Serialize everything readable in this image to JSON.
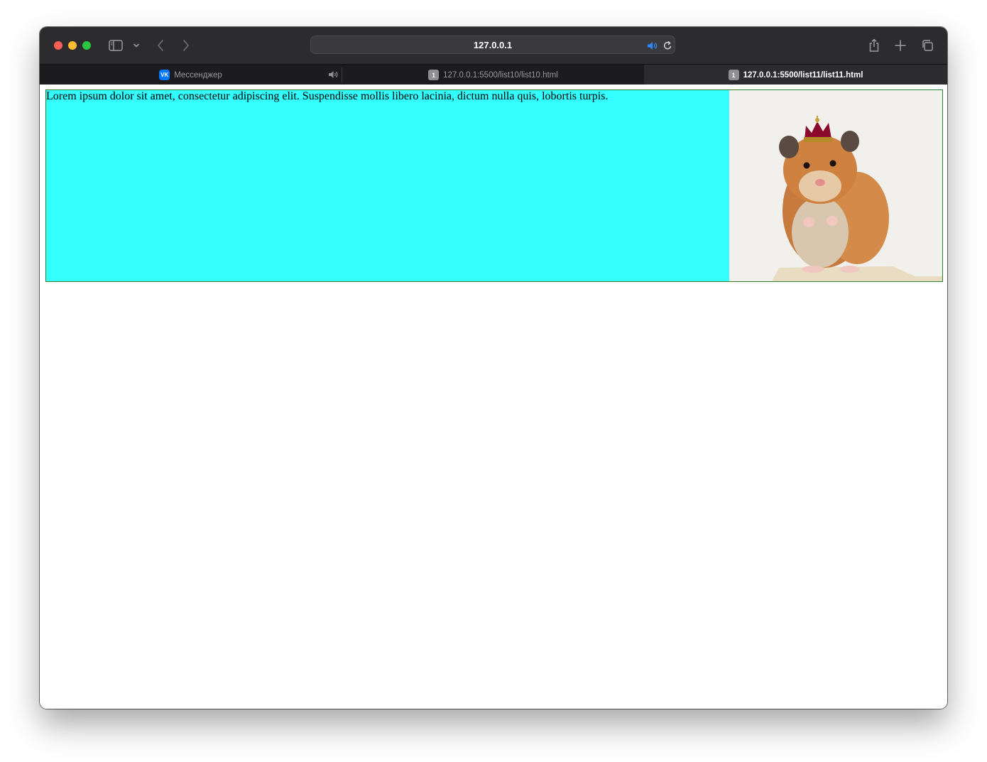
{
  "browser": {
    "address": "127.0.0.1",
    "tabs": [
      {
        "label": "Мессенджер",
        "favicon": "vk-icon",
        "audio": true,
        "active": false
      },
      {
        "label": "127.0.0.1:5500/list10/list10.html",
        "favicon_text": "1",
        "active": false
      },
      {
        "label": "127.0.0.1:5500/list11/list11.html",
        "favicon_text": "1",
        "active": true
      }
    ],
    "vk_favicon_text": "VK"
  },
  "page": {
    "paragraph": "Lorem ipsum dolor sit amet, consectetur adipiscing elit. Suspendisse mollis libero lacinia, dictum nulla quis, lobortis turpis.",
    "text_bg_color": "#33ffff",
    "border_color": "#2e7d32",
    "image": "hamster-with-crown"
  }
}
